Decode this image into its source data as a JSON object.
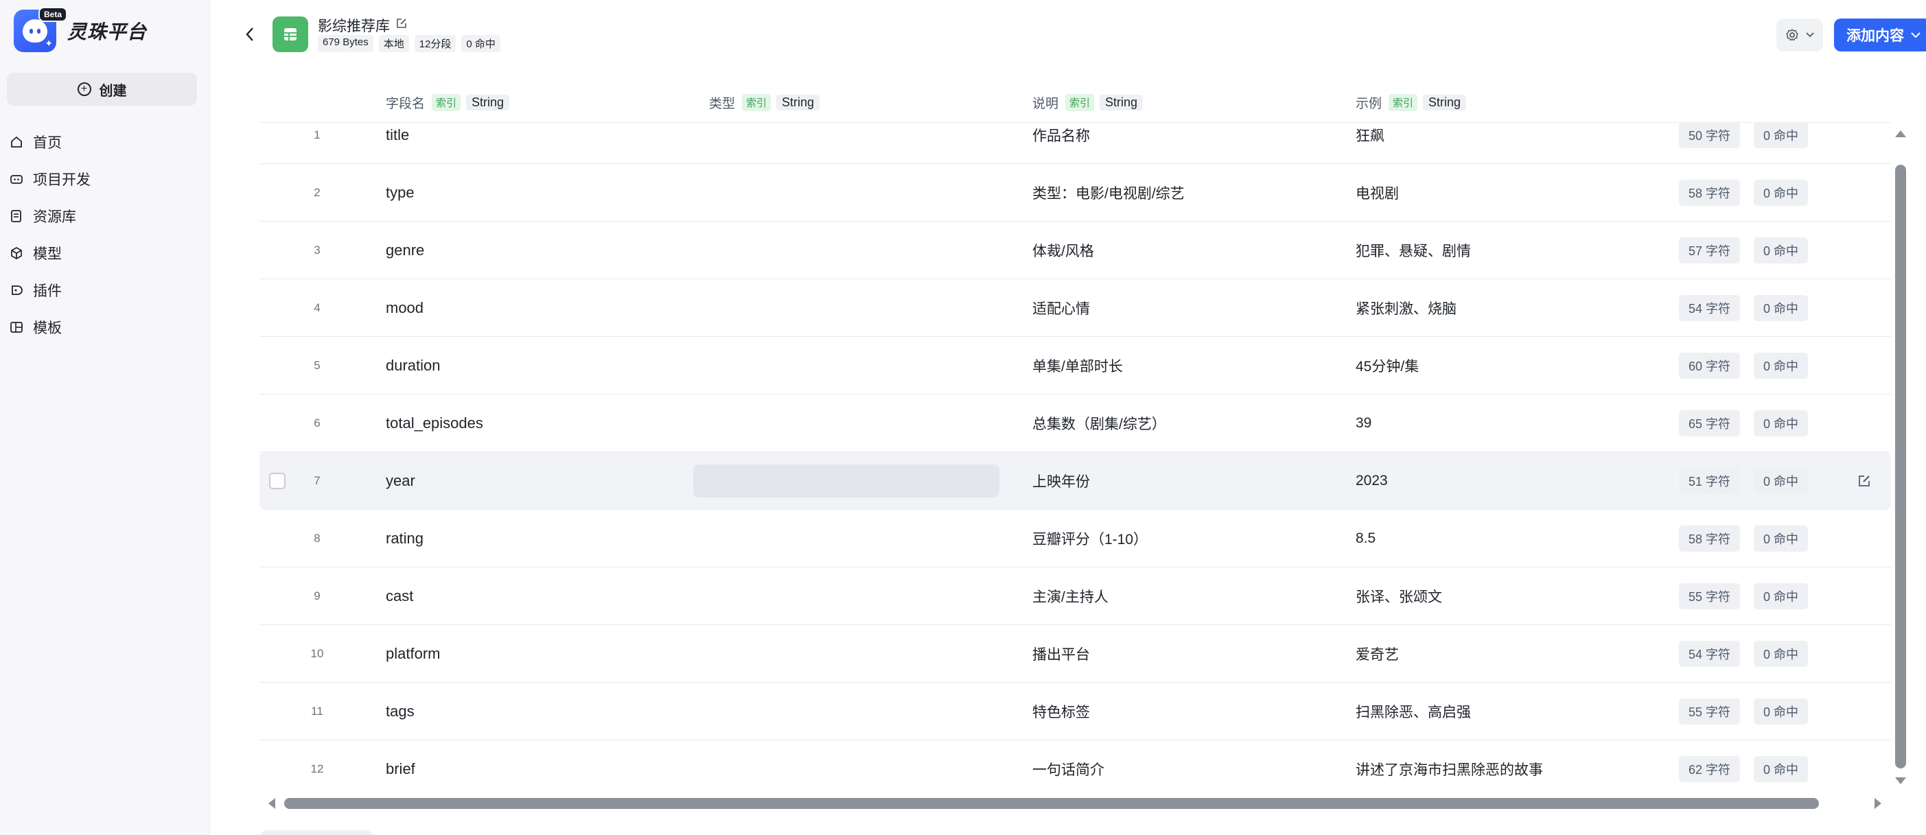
{
  "brand": {
    "name": "灵珠平台",
    "badge": "Beta"
  },
  "sidebar": {
    "create_label": "创建",
    "items": [
      {
        "label": "首页",
        "icon": "home-icon"
      },
      {
        "label": "项目开发",
        "icon": "robot-icon"
      },
      {
        "label": "资源库",
        "icon": "library-icon"
      },
      {
        "label": "模型",
        "icon": "cube-icon"
      },
      {
        "label": "插件",
        "icon": "plugin-icon"
      },
      {
        "label": "模板",
        "icon": "template-icon"
      }
    ]
  },
  "header": {
    "title": "影综推荐库",
    "meta": {
      "size": "679 Bytes",
      "location": "本地",
      "fields": "12分段",
      "hits": "0 命中"
    },
    "add_button": "添加内容"
  },
  "table": {
    "columns": [
      {
        "label": "字段名",
        "tag": "索引",
        "type": "String"
      },
      {
        "label": "类型",
        "tag": "索引",
        "type": "String"
      },
      {
        "label": "说明",
        "tag": "索引",
        "type": "String"
      },
      {
        "label": "示例",
        "tag": "索引",
        "type": "String"
      }
    ],
    "rows": [
      {
        "num": "1",
        "name": "title",
        "desc": "作品名称",
        "example": "狂飙",
        "chars": "50 字符",
        "hits": "0 命中"
      },
      {
        "num": "2",
        "name": "type",
        "desc": "类型：电影/电视剧/综艺",
        "example": "电视剧",
        "chars": "58 字符",
        "hits": "0 命中"
      },
      {
        "num": "3",
        "name": "genre",
        "desc": "体裁/风格",
        "example": "犯罪、悬疑、剧情",
        "chars": "57 字符",
        "hits": "0 命中"
      },
      {
        "num": "4",
        "name": "mood",
        "desc": "适配心情",
        "example": "紧张刺激、烧脑",
        "chars": "54 字符",
        "hits": "0 命中"
      },
      {
        "num": "5",
        "name": "duration",
        "desc": "单集/单部时长",
        "example": "45分钟/集",
        "chars": "60 字符",
        "hits": "0 命中"
      },
      {
        "num": "6",
        "name": "total_episodes",
        "desc": "总集数（剧集/综艺）",
        "example": "39",
        "chars": "65 字符",
        "hits": "0 命中"
      },
      {
        "num": "7",
        "name": "year",
        "desc": "上映年份",
        "example": "2023",
        "chars": "51 字符",
        "hits": "0 命中",
        "hovered": true
      },
      {
        "num": "8",
        "name": "rating",
        "desc": "豆瓣评分（1-10）",
        "example": "8.5",
        "chars": "58 字符",
        "hits": "0 命中"
      },
      {
        "num": "9",
        "name": "cast",
        "desc": "主演/主持人",
        "example": "张译、张颂文",
        "chars": "55 字符",
        "hits": "0 命中"
      },
      {
        "num": "10",
        "name": "platform",
        "desc": "播出平台",
        "example": "爱奇艺",
        "chars": "54 字符",
        "hits": "0 命中"
      },
      {
        "num": "11",
        "name": "tags",
        "desc": "特色标签",
        "example": "扫黑除恶、高启强",
        "chars": "55 字符",
        "hits": "0 命中"
      },
      {
        "num": "12",
        "name": "brief",
        "desc": "一句话简介",
        "example": "讲述了京海市扫黑除恶的故事",
        "chars": "62 字符",
        "hits": "0 命中"
      }
    ]
  },
  "colors": {
    "accent": "#2f65f5",
    "db_icon": "#4cb86a",
    "index_tag": "#3fa35a"
  }
}
